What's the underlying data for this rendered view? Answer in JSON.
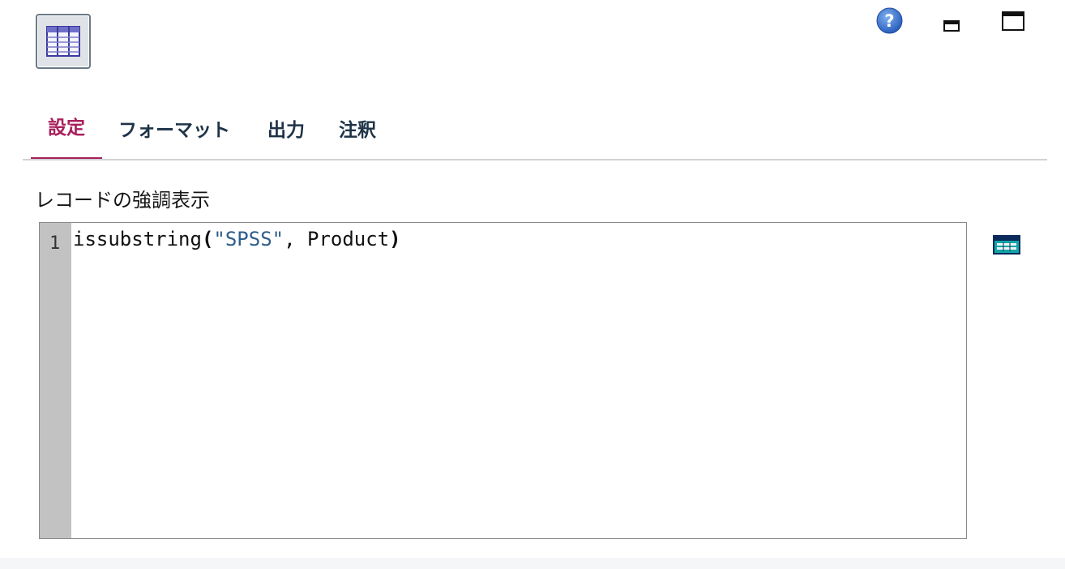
{
  "toolbar": {
    "node_icon": "table-node-icon",
    "help_icon": "help-icon",
    "minimize_icon": "minimize-icon",
    "maximize_icon": "maximize-icon"
  },
  "tabs": [
    {
      "label": "設定",
      "active": true
    },
    {
      "label": "フォーマット",
      "active": false
    },
    {
      "label": "出力",
      "active": false
    },
    {
      "label": "注釈",
      "active": false
    }
  ],
  "highlight": {
    "label": "レコードの強調表示",
    "line_number": "1",
    "code": {
      "func": "issubstring",
      "open_paren": "(",
      "string": "\"SPSS\"",
      "rest": ", Product",
      "close_paren": ")"
    },
    "expression_builder_icon": "expression-builder-icon"
  },
  "colors": {
    "accent": "#a81f5c",
    "string": "#2e5d8c",
    "gutter": "#c2c2c2"
  }
}
